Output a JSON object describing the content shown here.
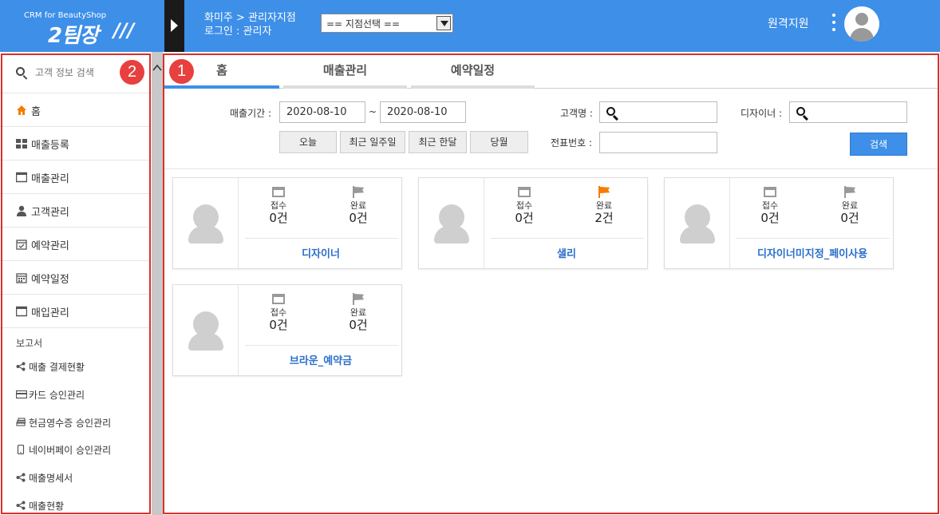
{
  "header": {
    "logo_sub": "CRM for BeautyShop",
    "logo_main": "2팀장",
    "branch_path": "화미주 > 관리자지점",
    "login": "로그인 : 관리자",
    "branch_select": "== 지점선택 ==",
    "remote_support": "원격지원",
    "bg_color": "#3d8fe8"
  },
  "badges": {
    "main": "1",
    "sidebar": "2"
  },
  "sidebar": {
    "search_placeholder": "고객 정보 검색",
    "items": [
      {
        "label": "홈",
        "icon": "home-icon"
      },
      {
        "label": "매출등록",
        "icon": "grid-icon"
      },
      {
        "label": "매출관리",
        "icon": "window-icon"
      },
      {
        "label": "고객관리",
        "icon": "user-icon"
      },
      {
        "label": "예약관리",
        "icon": "calendar-check-icon"
      },
      {
        "label": "예약일정",
        "icon": "calendar-icon"
      },
      {
        "label": "매입관리",
        "icon": "window-icon"
      }
    ],
    "report_title": "보고서",
    "reports": [
      {
        "label": "매출 결제현황",
        "icon": "share-icon"
      },
      {
        "label": "카드 승인관리",
        "icon": "card-icon"
      },
      {
        "label": "현금영수증 승인관리",
        "icon": "money-icon"
      },
      {
        "label": "네이버페이 승인관리",
        "icon": "mobile-icon"
      },
      {
        "label": "매출명세서",
        "icon": "share-icon"
      },
      {
        "label": "매출현황",
        "icon": "share-icon"
      }
    ]
  },
  "tabs": [
    {
      "label": "홈",
      "active": true
    },
    {
      "label": "매출관리",
      "active": false
    },
    {
      "label": "예약일정",
      "active": false
    }
  ],
  "filter": {
    "period_label": "매출기간 :",
    "date_from": "2020-08-10",
    "tilde": "~",
    "date_to": "2020-08-10",
    "customer_label": "고객명 :",
    "designer_label": "디자이너 :",
    "slip_label": "전표번호 :",
    "quick_buttons": [
      "오늘",
      "최근 일주일",
      "최근 한달",
      "당월"
    ],
    "search_button": "검색"
  },
  "cards": [
    {
      "name": "디자이너",
      "reception_label": "접수",
      "reception": "0건",
      "done_label": "완료",
      "done": "0건",
      "flag_color": "#999999"
    },
    {
      "name": "샐리",
      "reception_label": "접수",
      "reception": "0건",
      "done_label": "완료",
      "done": "2건",
      "flag_color": "#f57c00"
    },
    {
      "name": "디자이너미지정_페이사용",
      "reception_label": "접수",
      "reception": "0건",
      "done_label": "완료",
      "done": "0건",
      "flag_color": "#999999"
    },
    {
      "name": "브라운_예약금",
      "reception_label": "접수",
      "reception": "0건",
      "done_label": "완료",
      "done": "0건",
      "flag_color": "#999999"
    }
  ]
}
